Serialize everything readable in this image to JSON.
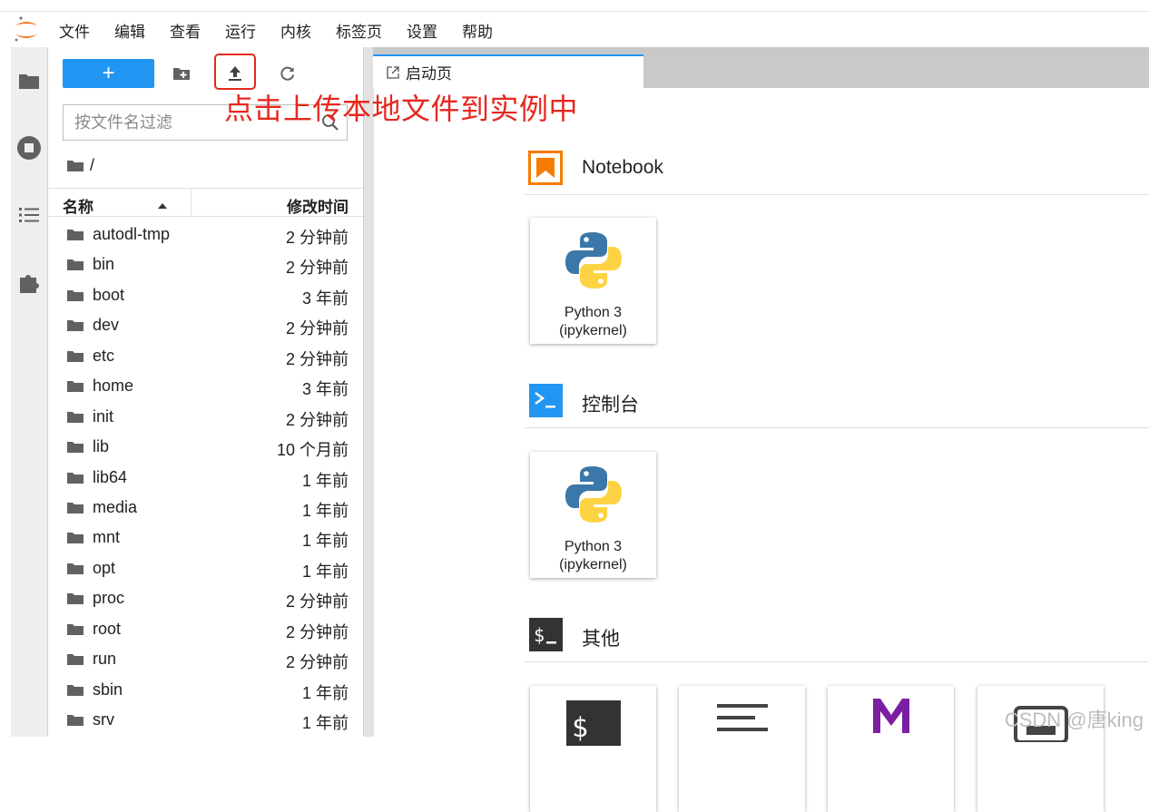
{
  "menu": [
    "文件",
    "编辑",
    "查看",
    "运行",
    "内核",
    "标签页",
    "设置",
    "帮助"
  ],
  "toolbar": {
    "new_label": "+"
  },
  "annotation": "点击上传本地文件到实例中",
  "filter": {
    "placeholder": "按文件名过滤"
  },
  "breadcrumb": "/",
  "columns": {
    "name": "名称",
    "modified": "修改时间"
  },
  "files": [
    {
      "name": "autodl-tmp",
      "modified": "2 分钟前"
    },
    {
      "name": "bin",
      "modified": "2 分钟前"
    },
    {
      "name": "boot",
      "modified": "3 年前"
    },
    {
      "name": "dev",
      "modified": "2 分钟前"
    },
    {
      "name": "etc",
      "modified": "2 分钟前"
    },
    {
      "name": "home",
      "modified": "3 年前"
    },
    {
      "name": "init",
      "modified": "2 分钟前"
    },
    {
      "name": "lib",
      "modified": "10 个月前"
    },
    {
      "name": "lib64",
      "modified": "1 年前"
    },
    {
      "name": "media",
      "modified": "1 年前"
    },
    {
      "name": "mnt",
      "modified": "1 年前"
    },
    {
      "name": "opt",
      "modified": "1 年前"
    },
    {
      "name": "proc",
      "modified": "2 分钟前"
    },
    {
      "name": "root",
      "modified": "2 分钟前"
    },
    {
      "name": "run",
      "modified": "2 分钟前"
    },
    {
      "name": "sbin",
      "modified": "1 年前"
    },
    {
      "name": "srv",
      "modified": "1 年前"
    }
  ],
  "tab": {
    "label": "启动页"
  },
  "launcher": {
    "notebook": {
      "title": "Notebook",
      "card_line1": "Python 3",
      "card_line2": "(ipykernel)"
    },
    "console": {
      "title": "控制台",
      "card_line1": "Python 3",
      "card_line2": "(ipykernel)"
    },
    "other": {
      "title": "其他"
    }
  },
  "watermark": "CSDN @唐king",
  "colors": {
    "accent": "#2196f3",
    "annotation_red": "#e5281f",
    "notebook_orange": "#f57c00"
  }
}
